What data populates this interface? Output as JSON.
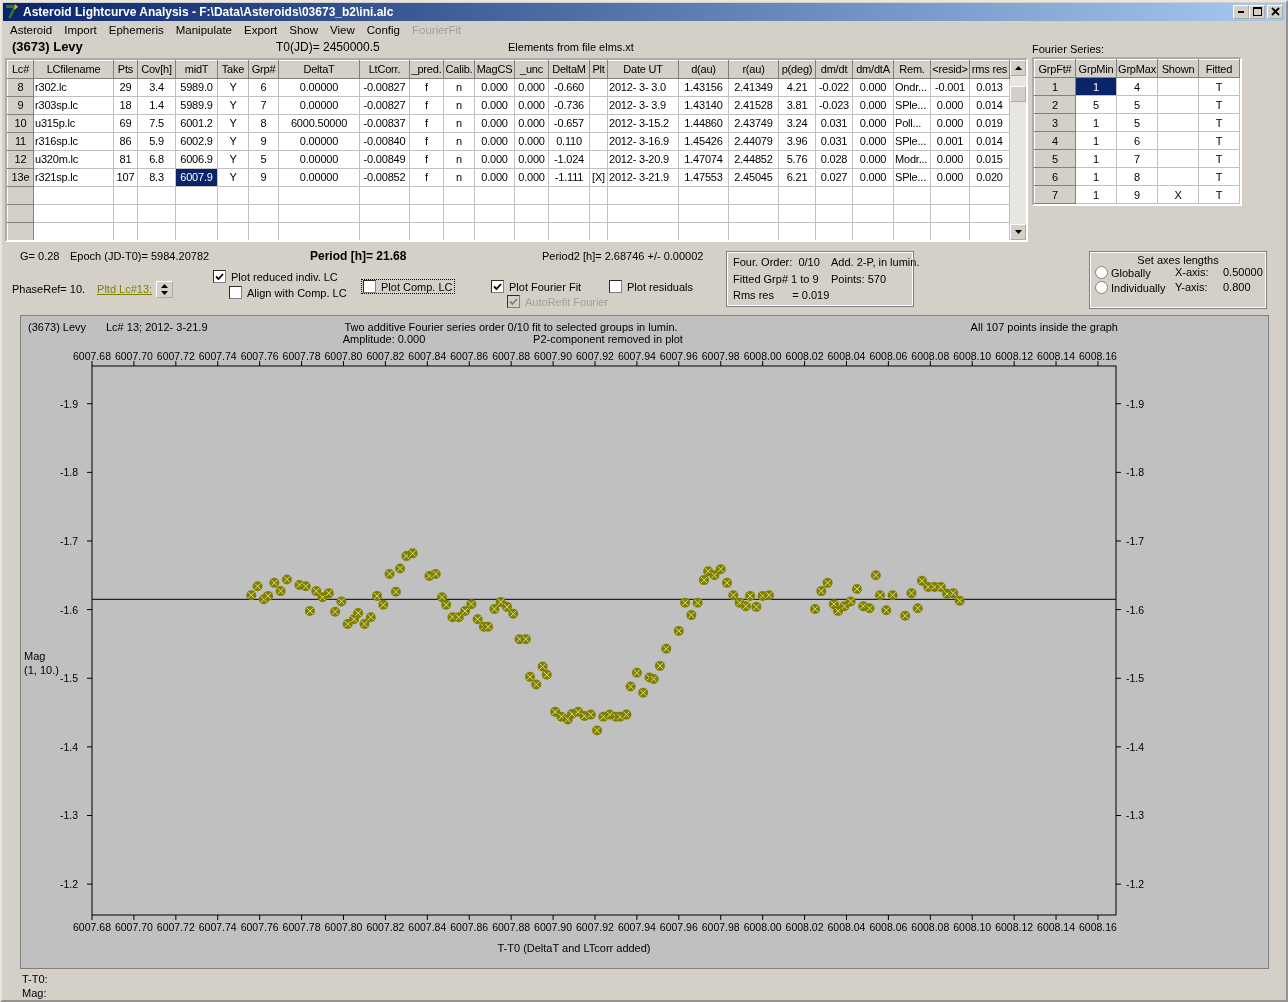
{
  "window": {
    "title": "Asteroid Lightcurve Analysis - F:\\Data\\Asteroids\\03673_b2\\ini.alc"
  },
  "menu": [
    {
      "label": "Asteroid",
      "disabled": false
    },
    {
      "label": "Import",
      "disabled": false
    },
    {
      "label": "Ephemeris",
      "disabled": false
    },
    {
      "label": "Manipulate",
      "disabled": false
    },
    {
      "label": "Export",
      "disabled": false
    },
    {
      "label": "Show",
      "disabled": false
    },
    {
      "label": "View",
      "disabled": false
    },
    {
      "label": "Config",
      "disabled": false
    },
    {
      "label": "FourierFit",
      "disabled": true
    }
  ],
  "asteroid": "(3673) Levy",
  "t0": "T0(JD)= 2450000.5",
  "elements_note": "Elements from file elms.xt",
  "table": {
    "columns": [
      {
        "label": "Lc#",
        "kind": "header",
        "current": false
      },
      {
        "label": "LCfilename",
        "kind": "text",
        "current": false
      },
      {
        "label": "Pts",
        "kind": "number",
        "current": false
      },
      {
        "label": "Cov[h]",
        "kind": "number",
        "current": false
      },
      {
        "label": "midT",
        "kind": "number",
        "current": true
      },
      {
        "label": "Take",
        "kind": "number",
        "current": false
      },
      {
        "label": "Grp#",
        "kind": "number",
        "current": false
      },
      {
        "label": "DeltaT",
        "kind": "number",
        "current": false
      },
      {
        "label": "LtCorr.",
        "kind": "number",
        "current": false
      },
      {
        "label": "_pred.",
        "kind": "number",
        "current": false
      },
      {
        "label": "Calib.",
        "kind": "number",
        "current": false
      },
      {
        "label": "MagCS",
        "kind": "number",
        "current": false
      },
      {
        "label": "_unc",
        "kind": "number",
        "current": false
      },
      {
        "label": "DeltaM",
        "kind": "number",
        "current": false
      },
      {
        "label": "Plt",
        "kind": "flag",
        "current": false
      },
      {
        "label": "Date UT",
        "kind": "text",
        "current": false
      },
      {
        "label": "d(au)",
        "kind": "number",
        "current": false
      },
      {
        "label": "r(au)",
        "kind": "number",
        "current": false
      },
      {
        "label": "p(deg)",
        "kind": "number",
        "current": false
      },
      {
        "label": "dm/dt",
        "kind": "number",
        "current": false
      },
      {
        "label": "dm/dtA",
        "kind": "number",
        "current": false
      },
      {
        "label": "Rem.",
        "kind": "text",
        "current": false
      },
      {
        "label": "<resid>",
        "kind": "number",
        "current": false
      },
      {
        "label": "rms res",
        "kind": "number",
        "current": false
      }
    ],
    "rows": [
      {
        "selected": false,
        "cells": [
          "8",
          "r302.lc",
          "29",
          "3.4",
          "5989.0",
          "Y",
          "6",
          "0.00000",
          "-0.00827",
          "f",
          "n",
          "0.000",
          "0.000",
          "-0.660",
          "",
          "2012- 3- 3.0",
          "1.43156",
          "2.41349",
          "4.21",
          "-0.022",
          "0.000",
          "Ondr...",
          "-0.001",
          "0.013"
        ]
      },
      {
        "selected": false,
        "cells": [
          "9",
          "r303sp.lc",
          "18",
          "1.4",
          "5989.9",
          "Y",
          "7",
          "0.00000",
          "-0.00827",
          "f",
          "n",
          "0.000",
          "0.000",
          "-0.736",
          "",
          "2012- 3- 3.9",
          "1.43140",
          "2.41528",
          "3.81",
          "-0.023",
          "0.000",
          "SPle...",
          "0.000",
          "0.014"
        ]
      },
      {
        "selected": false,
        "cells": [
          "10",
          "u315p.lc",
          "69",
          "7.5",
          "6001.2",
          "Y",
          "8",
          "6000.50000",
          "-0.00837",
          "f",
          "n",
          "0.000",
          "0.000",
          "-0.657",
          "",
          "2012- 3-15.2",
          "1.44860",
          "2.43749",
          "3.24",
          "0.031",
          "0.000",
          "Poll...",
          "0.000",
          "0.019"
        ]
      },
      {
        "selected": false,
        "cells": [
          "11",
          "r316sp.lc",
          "86",
          "5.9",
          "6002.9",
          "Y",
          "9",
          "0.00000",
          "-0.00840",
          "f",
          "n",
          "0.000",
          "0.000",
          "0.110",
          "",
          "2012- 3-16.9",
          "1.45426",
          "2.44079",
          "3.96",
          "0.031",
          "0.000",
          "SPle...",
          "0.001",
          "0.014"
        ]
      },
      {
        "selected": false,
        "cells": [
          "12",
          "u320m.lc",
          "81",
          "6.8",
          "6006.9",
          "Y",
          "5",
          "0.00000",
          "-0.00849",
          "f",
          "n",
          "0.000",
          "0.000",
          "-1.024",
          "",
          "2012- 3-20.9",
          "1.47074",
          "2.44852",
          "5.76",
          "0.028",
          "0.000",
          "Modr...",
          "0.000",
          "0.015"
        ]
      },
      {
        "selected": true,
        "cells": [
          "13e",
          "r321sp.lc",
          "107",
          "8.3",
          "6007.9",
          "Y",
          "9",
          "0.00000",
          "-0.00852",
          "f",
          "n",
          "0.000",
          "0.000",
          "-1.111",
          "[X]",
          "2012- 3-21.9",
          "1.47553",
          "2.45045",
          "6.21",
          "0.027",
          "0.000",
          "SPle...",
          "0.000",
          "0.020"
        ]
      }
    ]
  },
  "fourier": {
    "title": "Fourier Series:",
    "columns": [
      {
        "label": "GrpFt#",
        "kind": "header",
        "current": false
      },
      {
        "label": "GrpMin",
        "kind": "number",
        "current": true
      },
      {
        "label": "GrpMax",
        "kind": "number",
        "current": false
      },
      {
        "label": "Shown",
        "kind": "flag",
        "current": false
      },
      {
        "label": "Fitted",
        "kind": "number",
        "current": false
      }
    ],
    "rows": [
      {
        "selected": true,
        "cells": [
          "1",
          "1",
          "4",
          "",
          "T"
        ]
      },
      {
        "selected": false,
        "cells": [
          "2",
          "5",
          "5",
          "",
          "T"
        ]
      },
      {
        "selected": false,
        "cells": [
          "3",
          "1",
          "5",
          "",
          "T"
        ]
      },
      {
        "selected": false,
        "cells": [
          "4",
          "1",
          "6",
          "",
          "T"
        ]
      },
      {
        "selected": false,
        "cells": [
          "5",
          "1",
          "7",
          "",
          "T"
        ]
      },
      {
        "selected": false,
        "cells": [
          "6",
          "1",
          "8",
          "",
          "T"
        ]
      },
      {
        "selected": false,
        "cells": [
          "7",
          "1",
          "9",
          "X",
          "T"
        ]
      }
    ]
  },
  "params": {
    "g": "G= 0.28",
    "epoch": "Epoch (JD-T0)= 5984.20782",
    "period": "Period [h]= 21.68",
    "period2": "Period2 [h]= 2.68746 +/- 0.00002",
    "phase_ref": "PhaseRef= 10.",
    "plotted_lc": "Pltd Lc#13:"
  },
  "checkboxes": [
    {
      "label": "Plot reduced indiv. LC",
      "checked": true,
      "disabled": false,
      "focused": false
    },
    {
      "label": "Align with Comp. LC",
      "checked": false,
      "disabled": false,
      "focused": false
    },
    {
      "label": "Plot Comp. LC",
      "checked": false,
      "disabled": false,
      "focused": true
    },
    {
      "label": "Plot Fourier Fit",
      "checked": true,
      "disabled": false,
      "focused": false
    },
    {
      "label": "AutoRefit Fourier",
      "checked": true,
      "disabled": true,
      "focused": false
    },
    {
      "label": "Plot residuals",
      "checked": false,
      "disabled": false,
      "focused": false
    }
  ],
  "fit_info": [
    "Four. Order:  0/10",
    "Add. 2-P, in lumin.",
    "Fitted Grp# 1 to 9",
    "Points: 570",
    "Rms res      = 0.019"
  ],
  "axes": {
    "title": "Set axes lengths",
    "options": [
      {
        "label": "Globally",
        "selected": false
      },
      {
        "label": "Individually",
        "selected": false
      }
    ],
    "x_label": "X-axis:",
    "x_value": "0.50000",
    "y_label": "Y-axis:",
    "y_value": "0.800"
  },
  "plot": {
    "name": "(3673) Levy",
    "lc": "Lc# 13; 2012- 3-21.9",
    "fit_title": "Two additive Fourier series order 0/10 fit to selected groups in lumin.",
    "amplitude": "Amplitude: 0.000",
    "p2_note": "P2-component removed in plot",
    "points_note": "All 107 points inside the graph",
    "scale_note": "(1, 10.)",
    "chart_data": {
      "type": "scatter",
      "xlabel": "T-T0 (DeltaT and LTcorr added)",
      "ylabel": "Mag",
      "xlim": [
        6007.68,
        6008.1686
      ],
      "ylim": [
        -1.155,
        -1.955
      ],
      "xticks": [
        {
          "value": 6007.68,
          "label": "6007.68"
        },
        {
          "value": 6007.7,
          "label": "6007.70"
        },
        {
          "value": 6007.72,
          "label": "6007.72"
        },
        {
          "value": 6007.74,
          "label": "6007.74"
        },
        {
          "value": 6007.76,
          "label": "6007.76"
        },
        {
          "value": 6007.78,
          "label": "6007.78"
        },
        {
          "value": 6007.8,
          "label": "6007.80"
        },
        {
          "value": 6007.82,
          "label": "6007.82"
        },
        {
          "value": 6007.84,
          "label": "6007.84"
        },
        {
          "value": 6007.86,
          "label": "6007.86"
        },
        {
          "value": 6007.88,
          "label": "6007.88"
        },
        {
          "value": 6007.9,
          "label": "6007.90"
        },
        {
          "value": 6007.92,
          "label": "6007.92"
        },
        {
          "value": 6007.94,
          "label": "6007.94"
        },
        {
          "value": 6007.96,
          "label": "6007.96"
        },
        {
          "value": 6007.98,
          "label": "6007.98"
        },
        {
          "value": 6008.0,
          "label": "6008.00"
        },
        {
          "value": 6008.02,
          "label": "6008.02"
        },
        {
          "value": 6008.04,
          "label": "6008.04"
        },
        {
          "value": 6008.06,
          "label": "6008.06"
        },
        {
          "value": 6008.08,
          "label": "6008.08"
        },
        {
          "value": 6008.1,
          "label": "6008.10"
        },
        {
          "value": 6008.12,
          "label": "6008.12"
        },
        {
          "value": 6008.14,
          "label": "6008.14"
        },
        {
          "value": 6008.16,
          "label": "6008.16"
        }
      ],
      "yticks": [
        {
          "value": -1.9,
          "label": "-1.9"
        },
        {
          "value": -1.8,
          "label": "-1.8"
        },
        {
          "value": -1.7,
          "label": "-1.7"
        },
        {
          "value": -1.6,
          "label": "-1.6"
        },
        {
          "value": -1.5,
          "label": "-1.5"
        },
        {
          "value": -1.4,
          "label": "-1.4"
        },
        {
          "value": -1.3,
          "label": "-1.3"
        },
        {
          "value": -1.2,
          "label": "-1.2"
        }
      ],
      "x": [
        6007.756,
        6007.759,
        6007.762,
        6007.764,
        6007.767,
        6007.77,
        6007.773,
        6007.779,
        6007.782,
        6007.784,
        6007.787,
        6007.79,
        6007.793,
        6007.796,
        6007.799,
        6007.802,
        6007.805,
        6007.807,
        6007.81,
        6007.813,
        6007.816,
        6007.819,
        6007.822,
        6007.825,
        6007.827,
        6007.83,
        6007.833,
        6007.841,
        6007.844,
        6007.847,
        6007.849,
        6007.852,
        6007.855,
        6007.858,
        6007.861,
        6007.864,
        6007.867,
        6007.869,
        6007.872,
        6007.875,
        6007.878,
        6007.881,
        6007.884,
        6007.887,
        6007.889,
        6007.892,
        6007.895,
        6007.897,
        6007.901,
        6007.904,
        6007.907,
        6007.909,
        6007.912,
        6007.915,
        6007.918,
        6007.921,
        6007.924,
        6007.927,
        6007.93,
        6007.932,
        6007.935,
        6007.937,
        6007.94,
        6007.943,
        6007.946,
        6007.948,
        6007.951,
        6007.954,
        6007.96,
        6007.963,
        6007.966,
        6007.969,
        6007.972,
        6007.974,
        6007.977,
        6007.98,
        6007.983,
        6007.986,
        6007.989,
        6007.992,
        6007.994,
        6007.997,
        6008.0,
        6008.003,
        6008.025,
        6008.028,
        6008.031,
        6008.034,
        6008.036,
        6008.039,
        6008.042,
        6008.045,
        6008.048,
        6008.051,
        6008.054,
        6008.056,
        6008.059,
        6008.062,
        6008.068,
        6008.071,
        6008.074,
        6008.076,
        6008.079,
        6008.082,
        6008.085,
        6008.088,
        6008.091,
        6008.094
      ],
      "series": [
        {
          "color": "#808000",
          "values": [
            -1.621,
            -1.634,
            -1.615,
            -1.62,
            -1.639,
            -1.627,
            -1.644,
            -1.636,
            -1.634,
            -1.598,
            -1.627,
            -1.618,
            -1.624,
            -1.597,
            -1.612,
            -1.579,
            -1.586,
            -1.595,
            -1.579,
            -1.589,
            -1.62,
            -1.607,
            -1.652,
            -1.626,
            -1.66,
            -1.678,
            -1.682,
            -1.649,
            -1.652,
            -1.618,
            -1.607,
            -1.589,
            -1.589,
            -1.598,
            -1.608,
            -1.586,
            -1.575,
            -1.575,
            -1.601,
            -1.611,
            -1.604,
            -1.594,
            -1.557,
            -1.557,
            -1.502,
            -1.491,
            -1.517,
            -1.505,
            -1.451,
            -1.444,
            -1.44,
            -1.448,
            -1.451,
            -1.445,
            -1.447,
            -1.424,
            -1.444,
            -1.447,
            -1.444,
            -1.444,
            -1.447,
            -1.488,
            -1.508,
            -1.479,
            -1.501,
            -1.499,
            -1.518,
            -1.543,
            -1.569,
            -1.61,
            -1.592,
            -1.61,
            -1.643,
            -1.656,
            -1.65,
            -1.659,
            -1.639,
            -1.621,
            -1.61,
            -1.605,
            -1.62,
            -1.604,
            -1.62,
            -1.621,
            -1.601,
            -1.627,
            -1.639,
            -1.608,
            -1.598,
            -1.605,
            -1.612,
            -1.63,
            -1.605,
            -1.602,
            -1.65,
            -1.621,
            -1.599,
            -1.621,
            -1.591,
            -1.624,
            -1.602,
            -1.642,
            -1.633,
            -1.633,
            -1.633,
            -1.623,
            -1.624,
            -1.613
          ]
        }
      ],
      "ref_lines": [
        {
          "axis": "y",
          "value": -1.615
        }
      ]
    }
  },
  "status": {
    "t_label": "T-T0:",
    "mag_label": "Mag:"
  }
}
